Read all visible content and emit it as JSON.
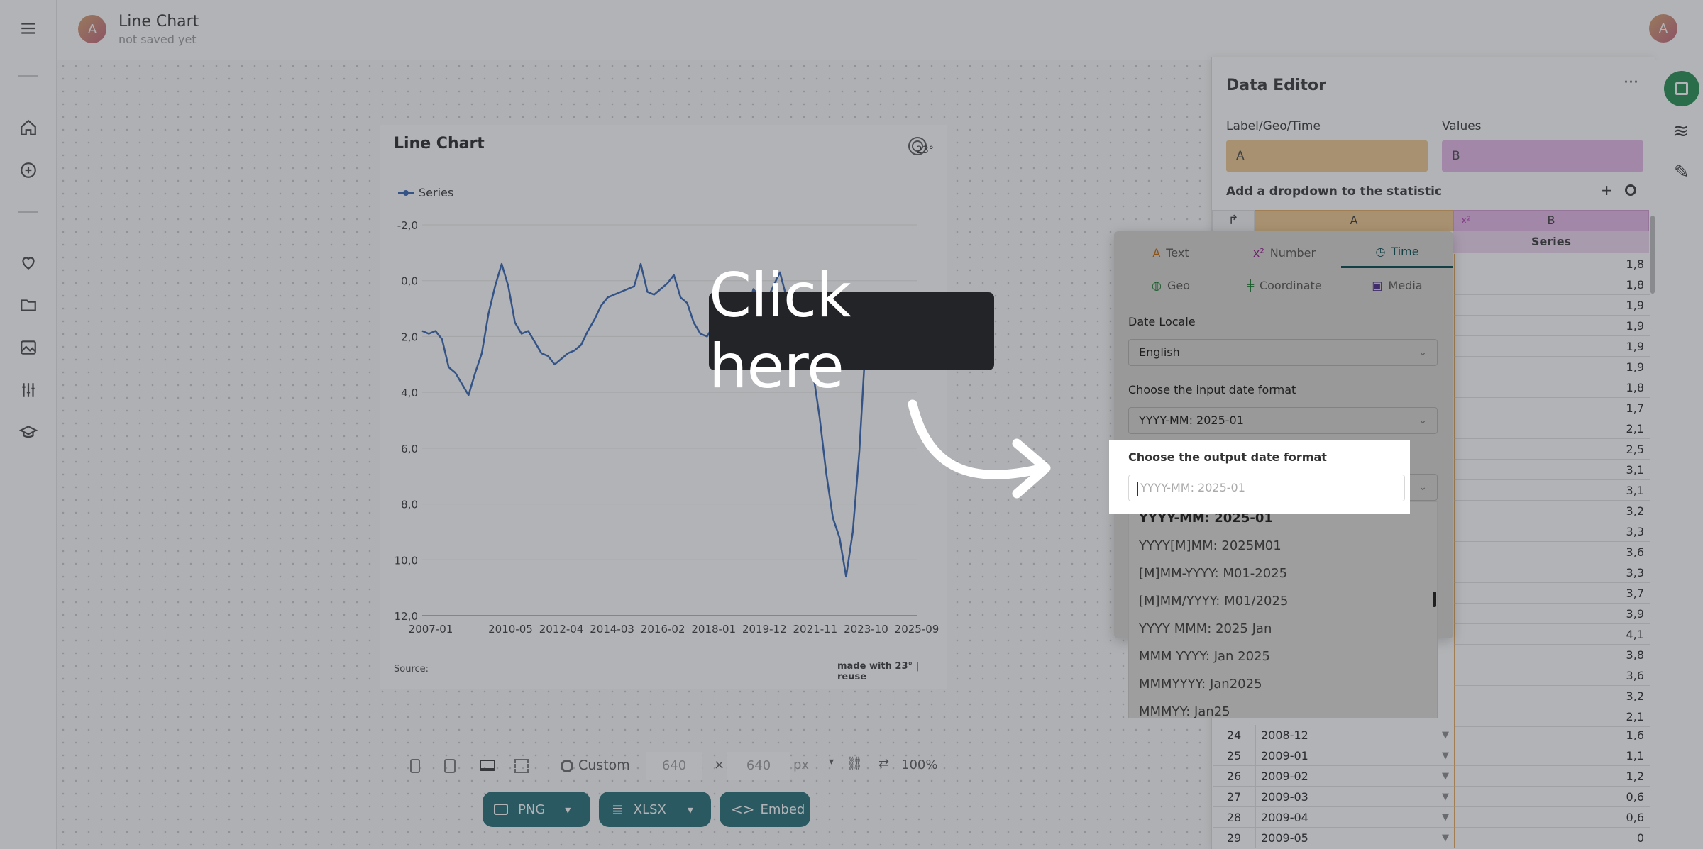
{
  "app": {
    "title": "Line Chart",
    "subtitle": "not saved yet",
    "avatar_letter": "A",
    "user_avatar_letter": "A"
  },
  "chart": {
    "title": "Line Chart",
    "legend_label": "Series",
    "source_label": "Source:",
    "credit": "made with 23° | reuse",
    "logo_text": "23°"
  },
  "chart_data": {
    "type": "line",
    "title": "Line Chart",
    "xlabel": "",
    "ylabel": "",
    "x_ticks": [
      "2007-01",
      "2010-05",
      "2012-04",
      "2014-03",
      "2016-02",
      "2018-01",
      "2019-12",
      "2021-11",
      "2023-10",
      "2025-09"
    ],
    "y_ticks": [
      "-2,0",
      "0,0",
      "2,0",
      "4,0",
      "6,0",
      "8,0",
      "10,0",
      "12,0"
    ],
    "ylim": [
      -2,
      12
    ],
    "y_inverted": true,
    "grid": true,
    "legend_position": "top-left",
    "series": [
      {
        "name": "Series",
        "color": "#2f5fb0",
        "x": [
          "2007-01",
          "2007-04",
          "2007-07",
          "2007-10",
          "2008-01",
          "2008-04",
          "2008-07",
          "2008-10",
          "2009-01",
          "2009-04",
          "2009-07",
          "2009-10",
          "2010-01",
          "2010-04",
          "2010-07",
          "2010-10",
          "2011-01",
          "2011-04",
          "2011-07",
          "2011-10",
          "2012-01",
          "2012-04",
          "2012-07",
          "2012-10",
          "2013-01",
          "2013-04",
          "2013-07",
          "2013-10",
          "2014-01",
          "2014-04",
          "2014-07",
          "2014-10",
          "2015-01",
          "2015-04",
          "2015-07",
          "2015-10",
          "2016-01",
          "2016-04",
          "2016-07",
          "2016-10",
          "2017-01",
          "2017-04",
          "2017-07",
          "2017-10",
          "2018-01",
          "2018-04",
          "2018-07",
          "2018-10",
          "2019-01",
          "2019-04",
          "2019-07",
          "2019-10",
          "2020-01",
          "2020-04",
          "2020-07",
          "2020-10",
          "2021-01",
          "2021-04",
          "2021-07",
          "2021-10",
          "2022-01",
          "2022-04",
          "2022-07",
          "2022-10",
          "2023-01",
          "2023-04",
          "2023-07",
          "2023-10"
        ],
        "values": [
          1.8,
          1.9,
          1.8,
          2.1,
          3.1,
          3.3,
          3.7,
          4.1,
          3.3,
          2.6,
          1.2,
          0.2,
          -0.6,
          0.2,
          1.5,
          1.9,
          1.8,
          2.2,
          2.6,
          2.7,
          3.0,
          2.8,
          2.6,
          2.5,
          2.3,
          1.8,
          1.4,
          0.9,
          0.6,
          0.5,
          0.4,
          0.3,
          0.2,
          -0.6,
          0.4,
          0.5,
          0.3,
          0.1,
          -0.2,
          0.6,
          0.8,
          1.5,
          1.9,
          2.0,
          1.6,
          1.4,
          1.7,
          1.6,
          1.8,
          1.1,
          0.3,
          0.6,
          0.7,
          0.2,
          -0.3,
          0.6,
          0.8,
          1.2,
          2.1,
          3.3,
          4.9,
          6.9,
          8.5,
          9.2,
          10.6,
          9.0,
          6.1,
          2.0
        ]
      }
    ]
  },
  "toolbar": {
    "custom_label": "Custom",
    "width": "640",
    "times": "×",
    "height": "640",
    "unit": "px",
    "zoom": "100%",
    "png": "PNG",
    "xlsx": "XLSX",
    "embed": "Embed"
  },
  "editor": {
    "title": "Data Editor",
    "menu": "···",
    "label_geo_time": "Label/Geo/Time",
    "values": "Values",
    "col_a_letter": "A",
    "col_b_letter": "B",
    "add_dropdown": "Add a dropdown to the statistic",
    "plus": "+",
    "header_a": "A",
    "header_b": "B",
    "series_header": "Series",
    "x2": "x²"
  },
  "col_b_values_top": [
    "1,8",
    "1,8",
    "1,9",
    "1,9",
    "1,9",
    "1,9",
    "1,8",
    "1,7",
    "2,1",
    "2,5",
    "3,1",
    "3,1",
    "3,2",
    "3,3",
    "3,6",
    "3,3",
    "3,7",
    "3,9",
    "4,1",
    "3,8",
    "3,6",
    "3,2",
    "2,1"
  ],
  "rows_visible": [
    {
      "n": "24",
      "a": "2008-12",
      "b": "1,6"
    },
    {
      "n": "25",
      "a": "2009-01",
      "b": "1,1"
    },
    {
      "n": "26",
      "a": "2009-02",
      "b": "1,2"
    },
    {
      "n": "27",
      "a": "2009-03",
      "b": "0,6"
    },
    {
      "n": "28",
      "a": "2009-04",
      "b": "0,6"
    },
    {
      "n": "29",
      "a": "2009-05",
      "b": "0"
    }
  ],
  "popup": {
    "tabs": [
      "Text",
      "Number",
      "Time",
      "Geo",
      "Coordinate",
      "Media"
    ],
    "active_tab": "Time",
    "date_locale_label": "Date Locale",
    "date_locale_value": "English",
    "input_format_label": "Choose the input date format",
    "input_format_value": "YYYY-MM: 2025-01",
    "output_format_label": "Choose the output date format",
    "output_format_placeholder": "YYYY-MM: 2025-01",
    "options": [
      "YYYY-MM: 2025-01",
      "YYYY[M]MM: 2025M01",
      "[M]MM-YYYY: M01-2025",
      "[M]MM/YYYY: M01/2025",
      "YYYY MMM: 2025 Jan",
      "MMM YYYY: Jan 2025",
      "MMMYYYY: Jan2025",
      "MMMYY: Jan25"
    ]
  },
  "tooltip": {
    "text": "Click here"
  },
  "colors": {
    "accent": "#1f6a73",
    "col_a": "#f0c68a",
    "col_b": "#e7b6e8",
    "line": "#2f5fb0",
    "save_green": "#1e8a4c"
  }
}
